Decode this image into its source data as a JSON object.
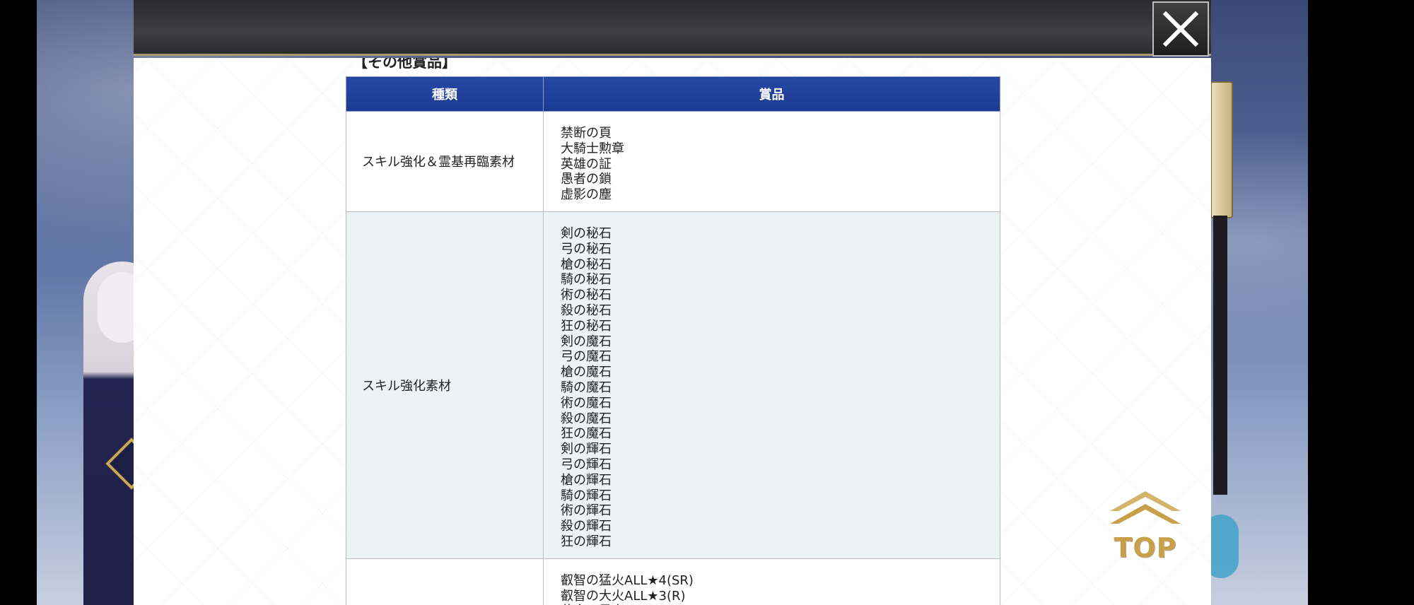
{
  "section_title": "【その他賞品】",
  "table": {
    "headers": {
      "type": "種類",
      "prize": "賞品"
    },
    "rows": [
      {
        "type": "スキル強化＆霊基再臨素材",
        "items": [
          "禁断の頁",
          "大騎士勲章",
          "英雄の証",
          "愚者の鎖",
          "虚影の塵"
        ]
      },
      {
        "type": "スキル強化素材",
        "items": [
          "剣の秘石",
          "弓の秘石",
          "槍の秘石",
          "騎の秘石",
          "術の秘石",
          "殺の秘石",
          "狂の秘石",
          "剣の魔石",
          "弓の魔石",
          "槍の魔石",
          "騎の魔石",
          "術の魔石",
          "殺の魔石",
          "狂の魔石",
          "剣の輝石",
          "弓の輝石",
          "槍の輝石",
          "騎の輝石",
          "術の輝石",
          "殺の輝石",
          "狂の輝石"
        ]
      },
      {
        "type": "",
        "items": [
          "叡智の猛火ALL★4(SR)",
          "叡智の大火ALL★3(R)",
          "黄金の果実"
        ]
      }
    ]
  },
  "buttons": {
    "top_label": "TOP"
  },
  "icons": {
    "close": "close-icon",
    "top": "chevron-up-icon"
  },
  "colors": {
    "header_blue": "#1a3a92",
    "alt_row": "#edf3f4",
    "gold": "#c9a04a"
  }
}
